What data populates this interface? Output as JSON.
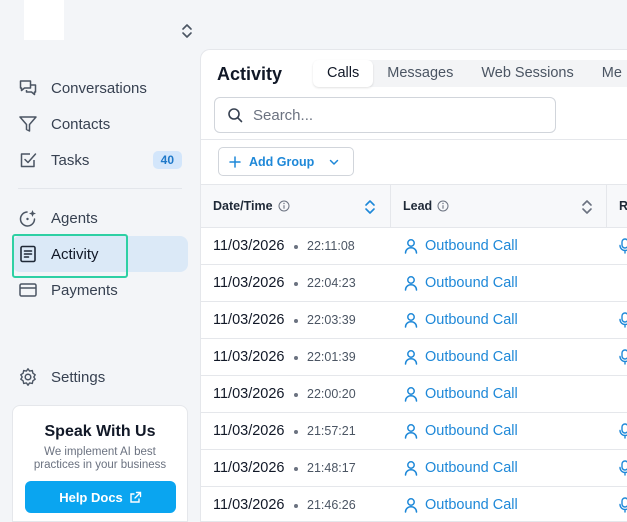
{
  "sidebar": {
    "nav_items": [
      {
        "label": "Conversations",
        "icon": "chat-bubbles-icon"
      },
      {
        "label": "Contacts",
        "icon": "filter-icon"
      },
      {
        "label": "Tasks",
        "icon": "checkbox-icon",
        "badge": "40"
      },
      {
        "label": "Agents",
        "icon": "sparkle-agent-icon"
      },
      {
        "label": "Activity",
        "icon": "activity-list-icon",
        "active": true
      },
      {
        "label": "Payments",
        "icon": "credit-card-icon"
      }
    ],
    "settings_label": "Settings",
    "promo": {
      "title": "Speak With Us",
      "text": "We implement AI best practices in your business",
      "button_label": "Help Docs"
    }
  },
  "main": {
    "title": "Activity",
    "tabs": [
      "Calls",
      "Messages",
      "Web Sessions",
      "Me"
    ],
    "active_tab": "Calls",
    "search_placeholder": "Search...",
    "add_group_label": "Add Group",
    "columns": [
      "Date/Time",
      "Lead",
      "R"
    ],
    "rows": [
      {
        "date": "11/03/2026",
        "time": "22:11:08",
        "lead": "Outbound Call",
        "recording": true
      },
      {
        "date": "11/03/2026",
        "time": "22:04:23",
        "lead": "Outbound Call",
        "recording": false
      },
      {
        "date": "11/03/2026",
        "time": "22:03:39",
        "lead": "Outbound Call",
        "recording": true
      },
      {
        "date": "11/03/2026",
        "time": "22:01:39",
        "lead": "Outbound Call",
        "recording": true
      },
      {
        "date": "11/03/2026",
        "time": "22:00:20",
        "lead": "Outbound Call",
        "recording": false
      },
      {
        "date": "11/03/2026",
        "time": "21:57:21",
        "lead": "Outbound Call",
        "recording": true
      },
      {
        "date": "11/03/2026",
        "time": "21:48:17",
        "lead": "Outbound Call",
        "recording": true
      },
      {
        "date": "11/03/2026",
        "time": "21:46:26",
        "lead": "Outbound Call",
        "recording": true
      }
    ]
  },
  "colors": {
    "accent": "#1e88d8",
    "active_nav_bg": "#dbe9f7",
    "focus_ring": "#2ed0a4",
    "help_button": "#0aa5f0"
  }
}
